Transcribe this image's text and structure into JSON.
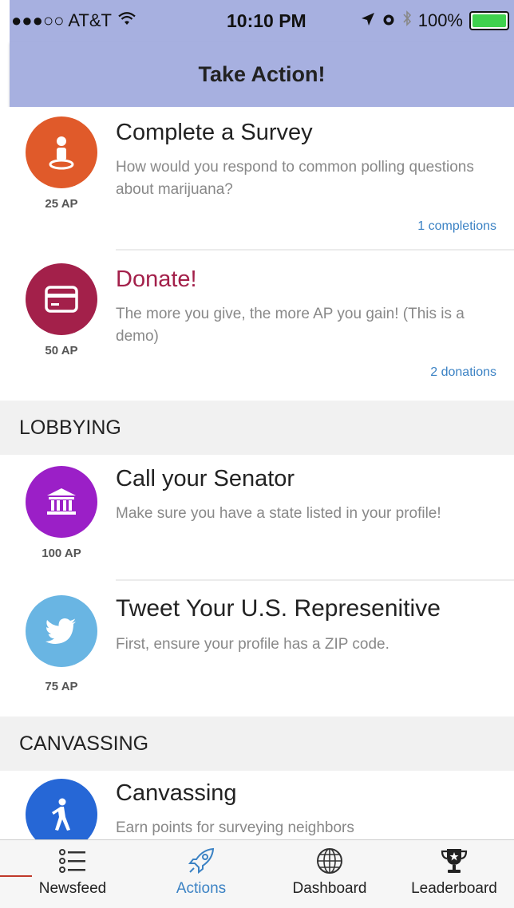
{
  "status_bar": {
    "carrier": "●●●○○ AT&T",
    "time": "10:10 PM",
    "battery": "100%"
  },
  "nav": {
    "title": "Take Action!"
  },
  "cards": [
    {
      "title": "Complete a Survey",
      "description": "How would you respond to common polling questions about marijuana?",
      "points": "25 AP",
      "meta": "1 completions",
      "icon": "person-pin-icon",
      "color": "#e05a2a",
      "title_color": "#222222"
    },
    {
      "title": "Donate!",
      "description": "The more you give, the more AP you gain! (This is a demo)",
      "points": "50 AP",
      "meta": "2 donations",
      "icon": "credit-card-icon",
      "color": "#a3204a",
      "title_color": "#a3204a"
    },
    {
      "title": "Call your Senator",
      "description": "Make sure you have a state listed in your profile!",
      "points": "100 AP",
      "meta": "",
      "icon": "capitol-building-icon",
      "color": "#9b1fc7",
      "title_color": "#222222"
    },
    {
      "title": "Tweet Your U.S. Represenitive",
      "description": "First, ensure your profile has a ZIP code.",
      "points": "75 AP",
      "meta": "",
      "icon": "twitter-bird-icon",
      "color": "#69b5e3",
      "title_color": "#222222"
    },
    {
      "title": "Canvassing",
      "description": "Earn points for surveying neighbors",
      "points": "",
      "meta": "",
      "icon": "walking-person-icon",
      "color": "#2667d6",
      "title_color": "#222222"
    }
  ],
  "sections": {
    "lobbying": "LOBBYING",
    "canvassing": "CANVASSING"
  },
  "tabs": [
    {
      "label": "Newsfeed",
      "icon": "list-icon",
      "active": false
    },
    {
      "label": "Actions",
      "icon": "rocket-icon",
      "active": true
    },
    {
      "label": "Dashboard",
      "icon": "globe-icon",
      "active": false
    },
    {
      "label": "Leaderboard",
      "icon": "trophy-icon",
      "active": false
    }
  ],
  "colors": {
    "nav_bg": "#a7b0e0",
    "accent": "#3b82c4"
  }
}
